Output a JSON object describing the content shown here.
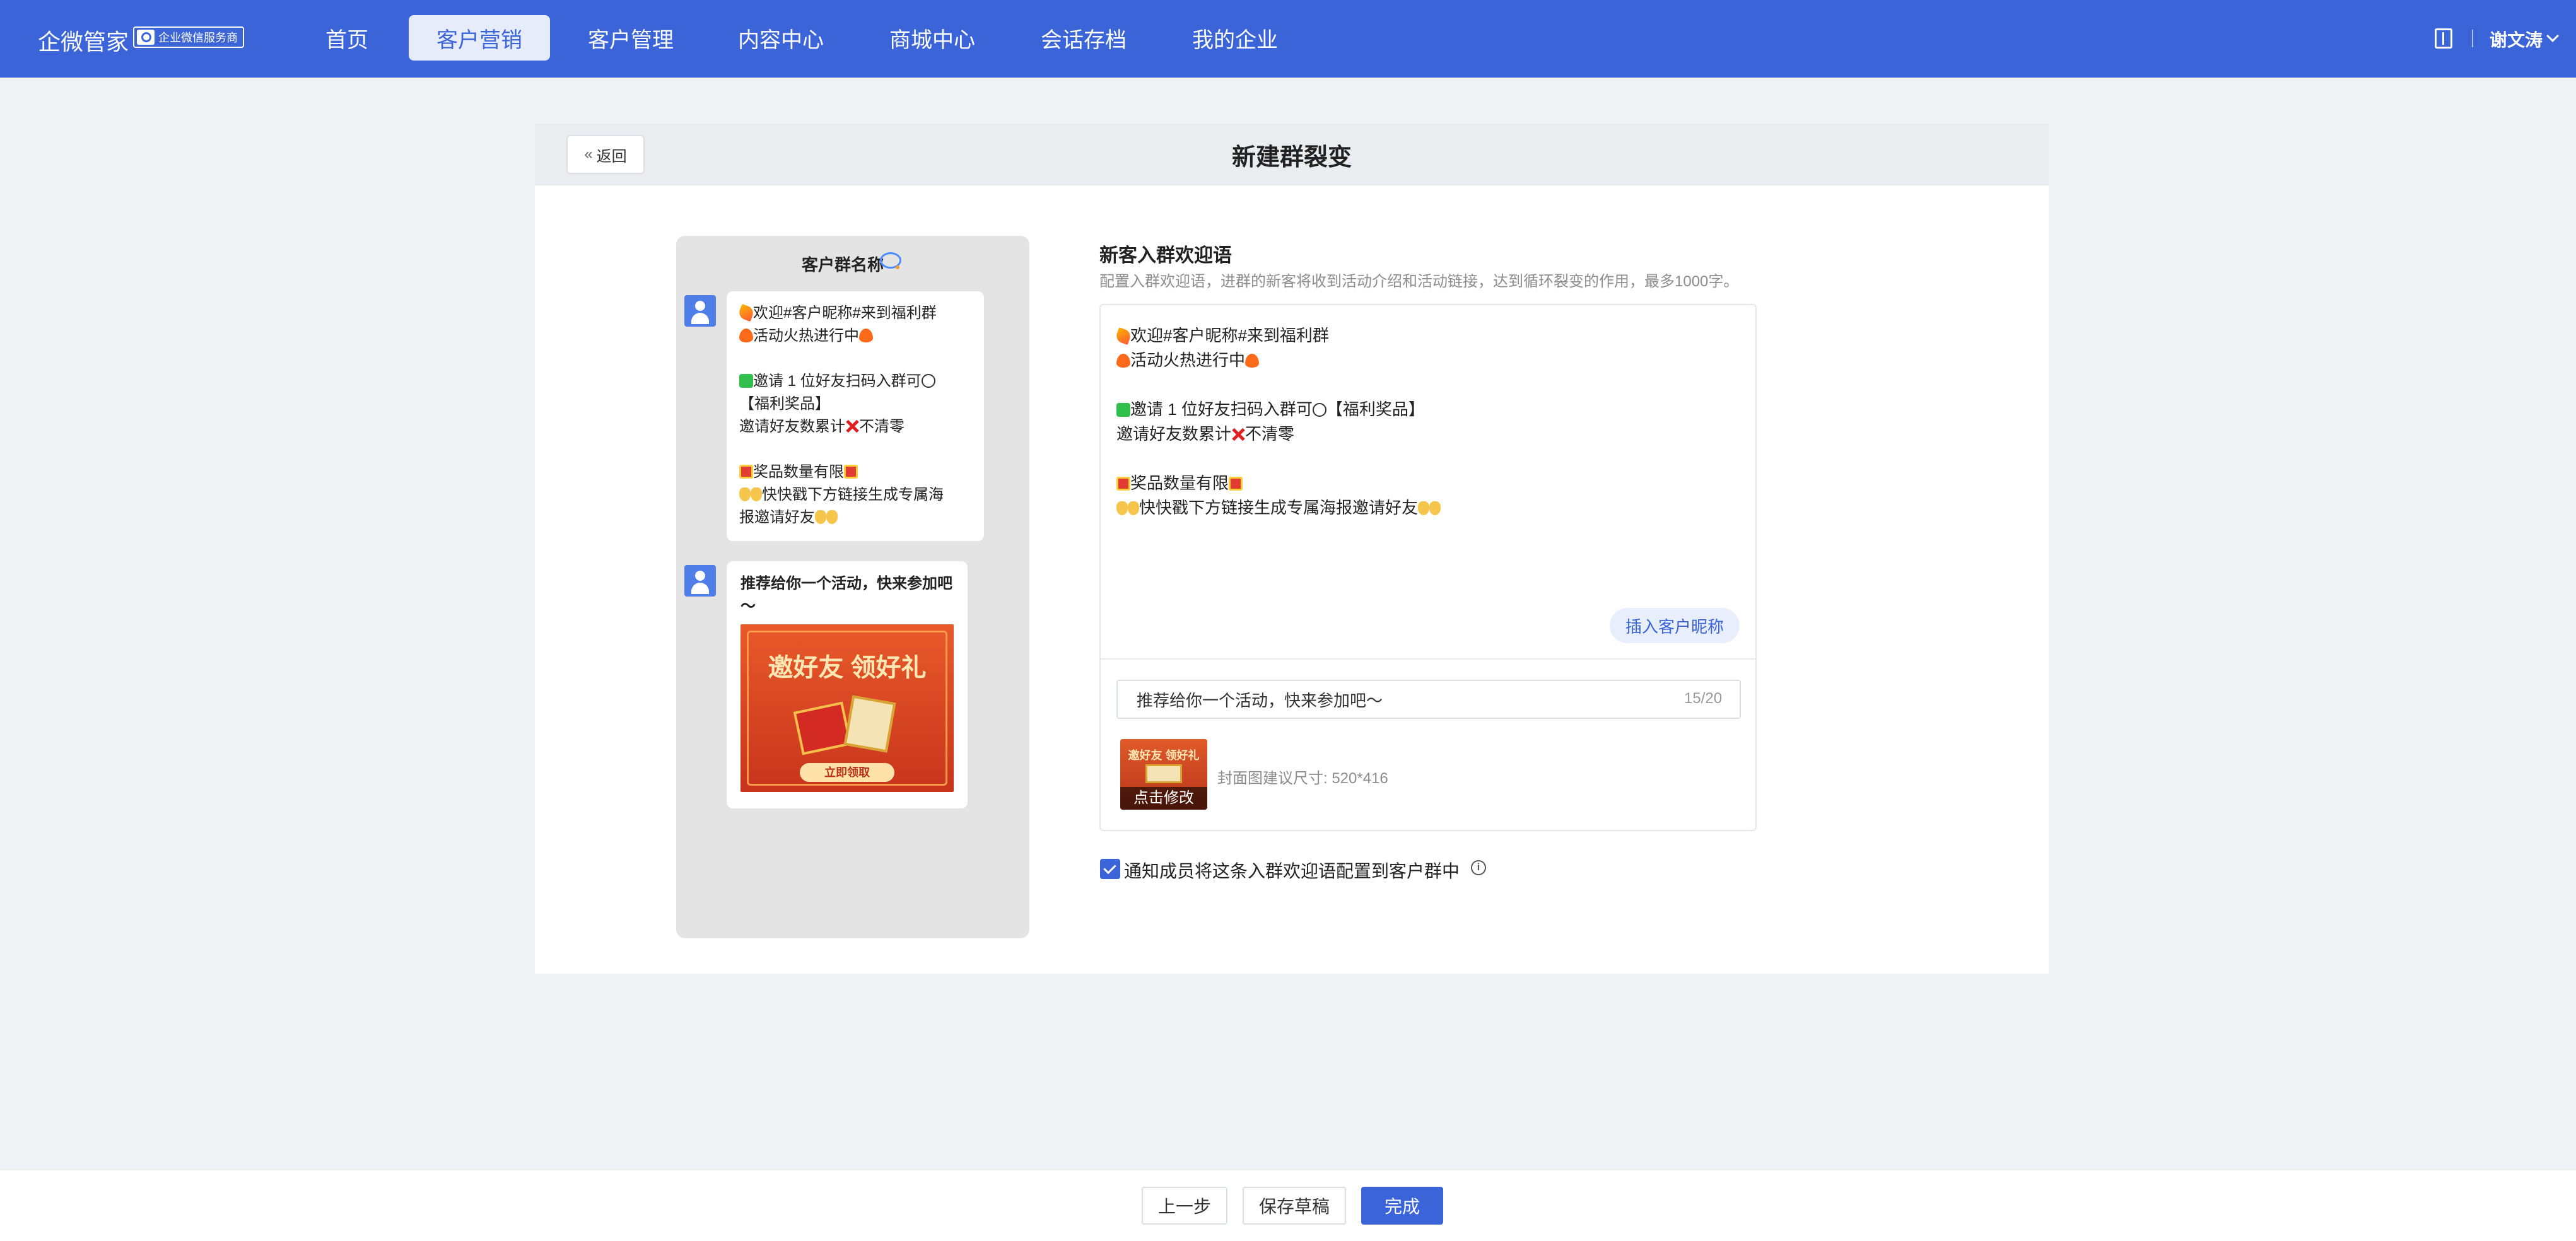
{
  "header": {
    "app_name": "企微管家",
    "badge": "企业微信服务商",
    "nav": [
      "首页",
      "客户营销",
      "客户管理",
      "内容中心",
      "商城中心",
      "会话存档",
      "我的企业"
    ],
    "active_nav": "客户营销",
    "user_name": "谢文涛",
    "brand_color": "#3a64d8"
  },
  "page": {
    "back_label": "返回",
    "title": "新建群裂变"
  },
  "preview": {
    "group_name": "客户群名称",
    "message_lines": [
      "欢迎#客户昵称#来到福利群",
      "活动火热进行中",
      "邀请 1 位好友扫码入群可",
      "【福利奖品】",
      "邀请好友数累计",
      "不清零",
      "奖品数量有限",
      "快快戳下方链接生成专属海",
      "报邀请好友"
    ],
    "link_title": "推荐给你一个活动，快来参加吧～",
    "banner_text": "邀好友 领好礼",
    "banner_button": "立即领取"
  },
  "form": {
    "section_title": "新客入群欢迎语",
    "section_desc": "配置入群欢迎语，进群的新客将收到活动介绍和活动链接，达到循环裂变的作用，最多1000字。",
    "editor_lines": [
      "欢迎#客户昵称#来到福利群",
      "活动火热进行中",
      "邀请 1 位好友扫码入群可",
      "【福利奖品】",
      "邀请好友数累计",
      "不清零",
      "奖品数量有限",
      "快快戳下方链接生成专属海报邀请好友"
    ],
    "insert_nickname_label": "插入客户昵称",
    "link_title_value": "推荐给你一个活动，快来参加吧～",
    "link_title_count": "15/20",
    "cover_title": "邀好友 领好礼",
    "cover_modify_label": "点击修改",
    "cover_hint": "封面图建议尺寸: 520*416",
    "notify_checked": true,
    "notify_label": "通知成员将这条入群欢迎语配置到客户群中",
    "info_icon": "info-icon"
  },
  "footer": {
    "prev_label": "上一步",
    "draft_label": "保存草稿",
    "finish_label": "完成"
  }
}
